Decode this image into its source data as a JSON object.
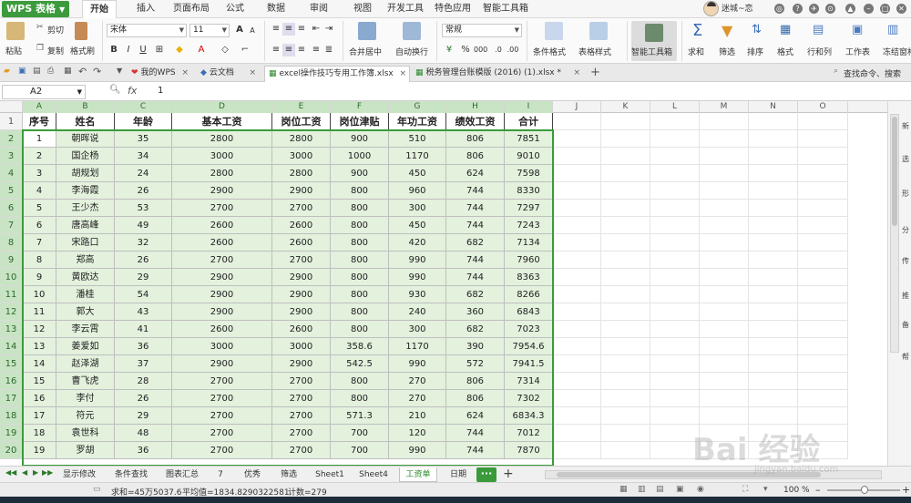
{
  "app": {
    "logo": "WPS 表格"
  },
  "menu": {
    "tabs": [
      "开始",
      "插入",
      "页面布局",
      "公式",
      "数据",
      "审阅",
      "视图",
      "开发工具",
      "特色应用",
      "智能工具箱"
    ],
    "active": 0
  },
  "user": {
    "name": "迷城~恋"
  },
  "ribbon": {
    "paste": "粘贴",
    "cut": "剪切",
    "copy": "复制",
    "format_painter": "格式刷",
    "font_name": "宋体",
    "font_size": "11",
    "merge_center": "合并居中",
    "wrap": "自动换行",
    "number_format": "常规",
    "cond_format": "条件格式",
    "table_style": "表格样式",
    "smart_toolbox": "智能工具箱",
    "sum": "求和",
    "filter": "筛选",
    "sort": "排序",
    "format": "格式",
    "row_col": "行和列",
    "worksheet": "工作表",
    "freeze": "冻结窗格"
  },
  "doc_tabs": [
    {
      "label": "我的WPS"
    },
    {
      "label": "云文档"
    },
    {
      "label": "excel操作技巧专用工作簿.xlsx"
    },
    {
      "label": "税务管理台账模版 (2016) (1).xlsx *"
    }
  ],
  "search_hint": "查找命令、搜索",
  "formula_bar": {
    "cell_ref": "A2",
    "fx": "fx",
    "value": "1"
  },
  "columns": [
    "A",
    "B",
    "C",
    "D",
    "E",
    "F",
    "G",
    "H",
    "I",
    "J",
    "K",
    "L",
    "M",
    "N",
    "O"
  ],
  "table": {
    "headers": [
      "序号",
      "姓名",
      "年龄",
      "基本工资",
      "岗位工资",
      "岗位津贴",
      "年功工资",
      "绩效工资",
      "合计"
    ],
    "rows": [
      [
        "1",
        "朝晖说",
        "35",
        "2800",
        "2800",
        "900",
        "510",
        "806",
        "7851"
      ],
      [
        "2",
        "国企杨",
        "34",
        "3000",
        "3000",
        "1000",
        "1170",
        "806",
        "9010"
      ],
      [
        "3",
        "胡规划",
        "24",
        "2800",
        "2800",
        "900",
        "450",
        "624",
        "7598"
      ],
      [
        "4",
        "李海霞",
        "26",
        "2900",
        "2900",
        "800",
        "960",
        "744",
        "8330"
      ],
      [
        "5",
        "王少杰",
        "53",
        "2700",
        "2700",
        "800",
        "300",
        "744",
        "7297"
      ],
      [
        "6",
        "唐高峰",
        "49",
        "2600",
        "2600",
        "800",
        "450",
        "744",
        "7243"
      ],
      [
        "7",
        "宋路口",
        "32",
        "2600",
        "2600",
        "800",
        "420",
        "682",
        "7134"
      ],
      [
        "8",
        "郑高",
        "26",
        "2700",
        "2700",
        "800",
        "990",
        "744",
        "7960"
      ],
      [
        "9",
        "黄欧达",
        "29",
        "2900",
        "2900",
        "800",
        "990",
        "744",
        "8363"
      ],
      [
        "10",
        "潘桂",
        "54",
        "2900",
        "2900",
        "800",
        "930",
        "682",
        "8266"
      ],
      [
        "11",
        "郭大",
        "43",
        "2900",
        "2900",
        "800",
        "240",
        "360",
        "6843"
      ],
      [
        "12",
        "李云霄",
        "41",
        "2600",
        "2600",
        "800",
        "300",
        "682",
        "7023"
      ],
      [
        "13",
        "姜爱如",
        "36",
        "3000",
        "3000",
        "358.6",
        "1170",
        "390",
        "7954.6"
      ],
      [
        "14",
        "赵泽湖",
        "37",
        "2900",
        "2900",
        "542.5",
        "990",
        "572",
        "7941.5"
      ],
      [
        "15",
        "曹飞虎",
        "28",
        "2700",
        "2700",
        "800",
        "270",
        "806",
        "7314"
      ],
      [
        "16",
        "李付",
        "26",
        "2700",
        "2700",
        "800",
        "270",
        "806",
        "7302"
      ],
      [
        "17",
        "符元",
        "29",
        "2700",
        "2700",
        "571.3",
        "210",
        "624",
        "6834.3"
      ],
      [
        "18",
        "袁世科",
        "48",
        "2700",
        "2700",
        "700",
        "120",
        "744",
        "7012"
      ],
      [
        "19",
        "罗胡",
        "36",
        "2700",
        "2700",
        "700",
        "990",
        "744",
        "7870"
      ]
    ]
  },
  "sheets": [
    "显示修改",
    "条件查找",
    "图表汇总",
    "7",
    "优秀",
    "筛选",
    "Sheet1",
    "Sheet4",
    "工资单",
    "日期"
  ],
  "active_sheet": "工资单",
  "side_items": [
    "新",
    "选",
    "形",
    "分",
    "传",
    "推",
    "备",
    "帮"
  ],
  "status": {
    "sum": "求和=45万5037.6",
    "avg": "平均值=1834.8290322581",
    "count": "计数=279",
    "zoom": "100 %"
  },
  "watermark": {
    "main": "Bai 经验",
    "sub": "jingyan.baidu.com"
  }
}
